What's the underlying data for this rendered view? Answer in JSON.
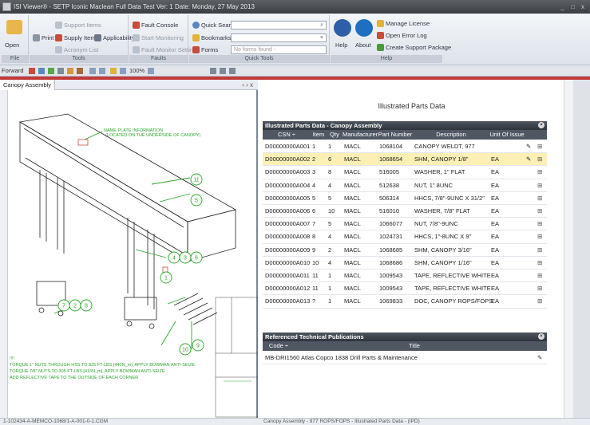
{
  "window": {
    "title": "ISI Viewer® - SETP Iconic Maclean Full Data Test Ver: 1 Date: Monday, 27 May 2013",
    "controls": "_ □ x"
  },
  "ribbon": {
    "file": {
      "open": "Open",
      "caption": "File"
    },
    "tools": {
      "print": "Print",
      "support_items": "Support Items",
      "supply_items": "Supply Items",
      "applicability": "Applicability",
      "acronym_list": "Acronym List",
      "caption": "Tools"
    },
    "faults": {
      "fault_console": "Fault Console",
      "start_monitoring": "Start Monitoring",
      "fault_monitor_settings": "Fault Monitor Settings",
      "caption": "Faults"
    },
    "quick_tools": {
      "quick_search": "Quick Search",
      "bookmarks": "Bookmarks",
      "forms": "Forms",
      "no_forms_found": "No forms found -",
      "caption": "Quick Tools"
    },
    "help": {
      "help": "Help",
      "about": "About",
      "manage_license": "Manage License",
      "open_error_log": "Open Error Log",
      "create_support_package": "Create Support Package",
      "caption": "Help"
    }
  },
  "toolbar": {
    "forward": "Forward",
    "zoom": "100%"
  },
  "left_pane": {
    "tab": "Canopy Assembly",
    "nav": "‹ › x",
    "callout": "NAME PLATE INFORMATION\n(LOCATED ON THE UNDERSIDE OF CANOPY)",
    "balloons": [
      "11",
      "5",
      "4",
      "3",
      "6",
      "1",
      "7",
      "2",
      "8",
      "10",
      "9"
    ],
    "notes": [
      "!!!!",
      "TORQUE 1\" NUTS THROUGH HSS TO 325 FT-LBS [440N_m]. APPLY BOWMAN ANTI-SEIZE",
      "TORQUE 7/8\" NUTS TO 305 FT-LBS [415N_m]. APPLY BOWMAN ANTI-SEIZE",
      "ADD REFLECTIVE TAPE TO THE OUTSIDE OF EACH CORNER"
    ]
  },
  "right_pane": {
    "heading": "Illustrated Parts Data",
    "parts_table": {
      "title": "Illustrated Parts Data - Canopy Assembly",
      "columns": [
        "CSN ÷",
        "Item",
        "Qty",
        "Manufacturer",
        "Part Number",
        "Description",
        "Unit Of Issue"
      ],
      "rows": [
        {
          "csn": "D00000000A001",
          "item": "1",
          "qty": "1",
          "mfr": "MACL",
          "pn": "1068104",
          "desc": "CANOPY WELDT, 977",
          "uoi": ""
        },
        {
          "csn": "D00000000A002",
          "item": "2",
          "qty": "6",
          "mfr": "MACL",
          "pn": "1068654",
          "desc": "SHM, CANOPY 1/8\"",
          "uoi": "EA"
        },
        {
          "csn": "D00000000A003",
          "item": "3",
          "qty": "8",
          "mfr": "MACL",
          "pn": "516005",
          "desc": "WASHER, 1\" FLAT",
          "uoi": "EA"
        },
        {
          "csn": "D00000000A004",
          "item": "4",
          "qty": "4",
          "mfr": "MACL",
          "pn": "512638",
          "desc": "NUT, 1\" 8UNC",
          "uoi": "EA"
        },
        {
          "csn": "D00000000A005",
          "item": "5",
          "qty": "5",
          "mfr": "MACL",
          "pn": "506314",
          "desc": "HHCS, 7/8\"-9UNC X 31/2\"",
          "uoi": "EA"
        },
        {
          "csn": "D00000000A006",
          "item": "6",
          "qty": "10",
          "mfr": "MACL",
          "pn": "516010",
          "desc": "WASHER, 7/8\" FLAT",
          "uoi": "EA"
        },
        {
          "csn": "D00000000A007",
          "item": "7",
          "qty": "5",
          "mfr": "MACL",
          "pn": "1066077",
          "desc": "NUT, 7/8\"-9UNC",
          "uoi": "EA"
        },
        {
          "csn": "D00000000A008",
          "item": "8",
          "qty": "4",
          "mfr": "MACL",
          "pn": "1024731",
          "desc": "HHCS, 1\"-8UNC X 9\"",
          "uoi": "EA"
        },
        {
          "csn": "D00000000A009",
          "item": "9",
          "qty": "2",
          "mfr": "MACL",
          "pn": "1068685",
          "desc": "SHM, CANOPY 3/16\"",
          "uoi": "EA"
        },
        {
          "csn": "D00000000A010",
          "item": "10",
          "qty": "4",
          "mfr": "MACL",
          "pn": "1068686",
          "desc": "SHM, CANOPY 1/16\"",
          "uoi": "EA"
        },
        {
          "csn": "D00000000A011",
          "item": "11",
          "qty": "1",
          "mfr": "MACL",
          "pn": "1009543",
          "desc": "TAPE, REFLECTIVE WHITE",
          "uoi": "EA"
        },
        {
          "csn": "D00000000A012",
          "item": "11",
          "qty": "1",
          "mfr": "MACL",
          "pn": "1009543",
          "desc": "TAPE, REFLECTIVE WHITE",
          "uoi": "EA"
        },
        {
          "csn": "D00000000A013",
          "item": "?",
          "qty": "1",
          "mfr": "MACL",
          "pn": "1069833",
          "desc": "DOC, CANOPY ROPS/FOPS",
          "uoi": "EA"
        }
      ]
    },
    "pubs_table": {
      "title": "Referenced Technical Publications",
      "columns": [
        "Code ÷",
        "Title"
      ],
      "rows": [
        {
          "code": "MB-DRI1560",
          "title": "Atlas Copco 1838 Drill Parts & Maintenance"
        }
      ]
    }
  },
  "status": {
    "left": "1-102434-A-MEMCO-1068/1-A-001-0-1.CGM",
    "right": "Canopy Assembly - 977 ROPS/FOPS - Illustrated Parts Data - (IPD)"
  }
}
